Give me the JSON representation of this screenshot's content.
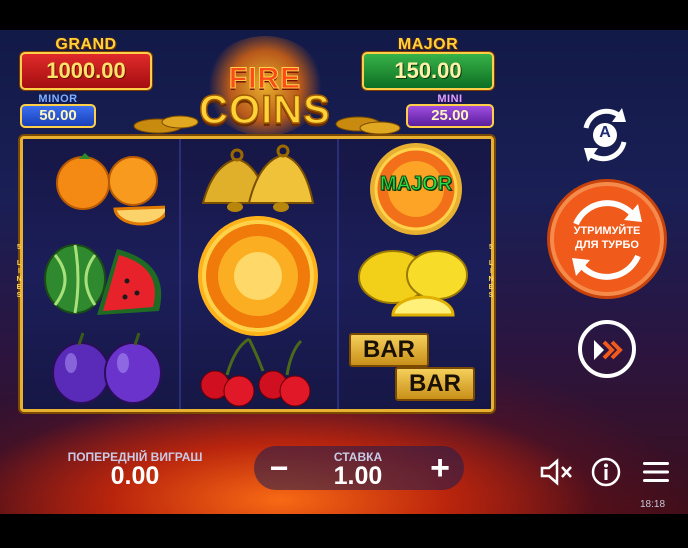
{
  "jackpots": {
    "grand": {
      "label": "GRAND",
      "value": "1000.00"
    },
    "major": {
      "label": "MAJOR",
      "value": "150.00"
    },
    "minor": {
      "label": "MINOR",
      "value": "50.00"
    },
    "mini": {
      "label": "MINI",
      "value": "25.00"
    }
  },
  "logo": {
    "line1": "FIRE",
    "line2": "COINS"
  },
  "reels": {
    "lines_left": "5 LINES",
    "lines_right": "5 LINES",
    "columns": [
      [
        "orange-icon",
        "watermelon-icon",
        "plum-icon"
      ],
      [
        "bell-icon",
        "fire-coin-icon",
        "cherry-icon"
      ],
      [
        "major-coin-icon",
        "lemon-icon",
        "bar-icon"
      ]
    ],
    "major_coin_text": "MAJOR",
    "bar_text": "BAR"
  },
  "controls": {
    "turbo_label_line1": "УТРИМУЙТЕ",
    "turbo_label_line2": "ДЛЯ ТУРБО",
    "autoplay_letter": "A"
  },
  "hud": {
    "last_win_label": "ПОПЕРЕДНІЙ ВИГРАШ",
    "last_win_value": "0.00",
    "bet_label": "СТАВКА",
    "bet_value": "1.00",
    "minus": "−",
    "plus": "+"
  },
  "status": {
    "clock": "18:18"
  },
  "colors": {
    "accent_orange": "#f05a1a",
    "gold": "#ffd23a",
    "frame": "#e8b030"
  }
}
